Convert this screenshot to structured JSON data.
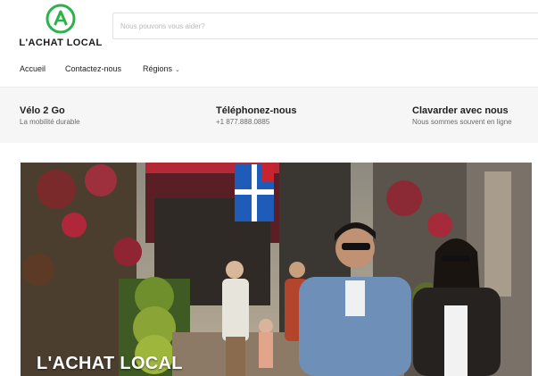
{
  "brand": {
    "name": "L'ACHAT LOCAL",
    "accent": "#2bb24c",
    "logo_icon": "a-circle-logo-icon"
  },
  "search": {
    "placeholder": "Nous pouvons vous aider?"
  },
  "nav": {
    "items": [
      {
        "label": "Accueil"
      },
      {
        "label": "Contactez-nous"
      },
      {
        "label": "Régions",
        "icon": "chevron-down-icon",
        "glyph": "⌄"
      }
    ]
  },
  "info": [
    {
      "title": "Vélo 2 Go",
      "subtitle": "La mobilité durable"
    },
    {
      "title": "Téléphonez-nous",
      "subtitle": "+1 877.888.0885"
    },
    {
      "title": "Clavarder avec nous",
      "subtitle": "Nous sommes souvent en ligne"
    }
  ],
  "hero": {
    "title": "L'ACHAT LOCAL"
  }
}
